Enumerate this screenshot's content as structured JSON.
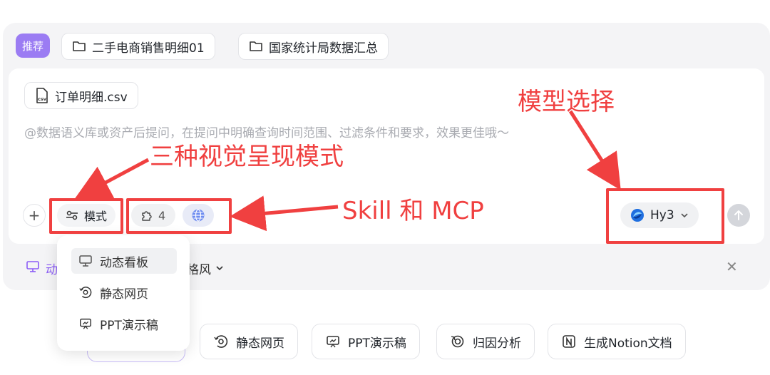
{
  "recommend_tag": "推荐",
  "datasets": [
    {
      "label": "二手电商销售明细01",
      "icon": "folder-icon"
    },
    {
      "label": "国家统计局数据汇总",
      "icon": "folder-icon"
    }
  ],
  "input": {
    "file_chip": {
      "label": "订单明细.csv",
      "icon": "csv-file-icon"
    },
    "placeholder": "@数据语义库或资产后提问，在提问中明确查询时间范围、过滤条件和要求，效果更佳哦～"
  },
  "toolbar": {
    "add_symbol": "+",
    "mode_label": "模式",
    "skill_count": "4",
    "model_label": "Hy3",
    "model_icon": "hunyuan-logo-icon"
  },
  "mode_dropdown": {
    "items": [
      {
        "label": "动态看板",
        "icon": "dashboard-icon",
        "active": true
      },
      {
        "label": "静态网页",
        "icon": "webpage-icon",
        "active": false
      },
      {
        "label": "PPT演示稿",
        "icon": "ppt-icon",
        "active": false
      }
    ]
  },
  "hint_row": {
    "left_fragment": "动",
    "right_fragment": "格风",
    "close_symbol": "✕"
  },
  "suggestion_chips": [
    {
      "label": "静态网页",
      "icon": "webpage-icon"
    },
    {
      "label": "PPT演示稿",
      "icon": "ppt-icon"
    },
    {
      "label": "归因分析",
      "icon": "attribution-icon"
    },
    {
      "label": "生成Notion文档",
      "icon": "notion-icon"
    }
  ],
  "annotations": {
    "model_select": "模型选择",
    "three_modes": "三种视觉呈现模式",
    "skill_mcp": "Skill 和 MCP"
  },
  "colors": {
    "annotation_red": "#f04040",
    "accent_purple": "#9b7cf3",
    "panel_bg": "#f4f4f6"
  }
}
